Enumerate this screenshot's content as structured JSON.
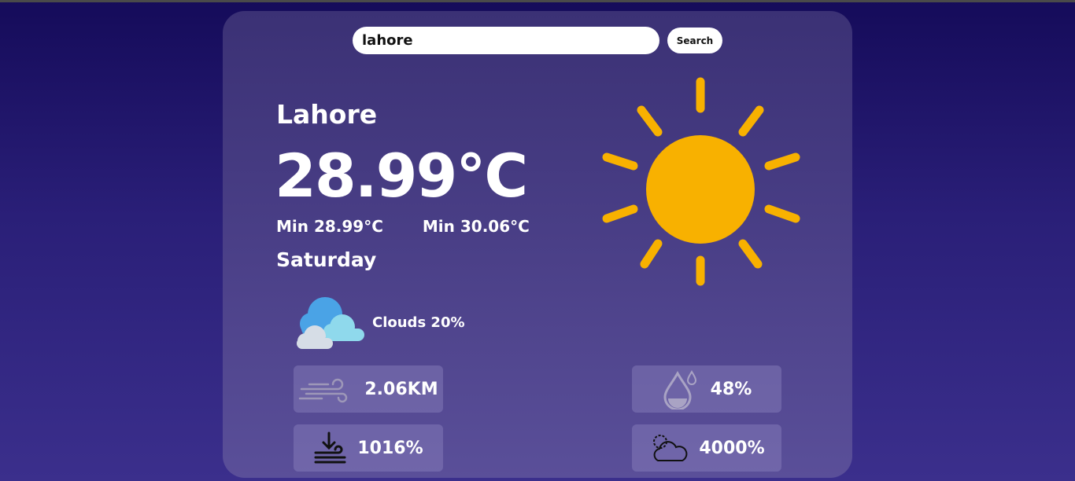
{
  "search": {
    "value": "lahore",
    "button_label": "Search"
  },
  "weather": {
    "city": "Lahore",
    "temperature": "28.99°C",
    "min_label": "Min 28.99°C",
    "max_label": "Min 30.06°C",
    "day": "Saturday",
    "condition_icon": "sun-icon",
    "clouds_label": "Clouds 20%"
  },
  "stats": {
    "wind": {
      "value": "2.06KM",
      "icon": "wind-icon"
    },
    "humidity": {
      "value": "48%",
      "icon": "humidity-drop-icon"
    },
    "pressure": {
      "value": "1016%",
      "icon": "pressure-icon"
    },
    "visibility": {
      "value": "4000%",
      "icon": "sun-cloud-icon"
    }
  },
  "colors": {
    "sun": "#f8b100",
    "background_top": "#150b5a",
    "card": "#4a3f87"
  }
}
